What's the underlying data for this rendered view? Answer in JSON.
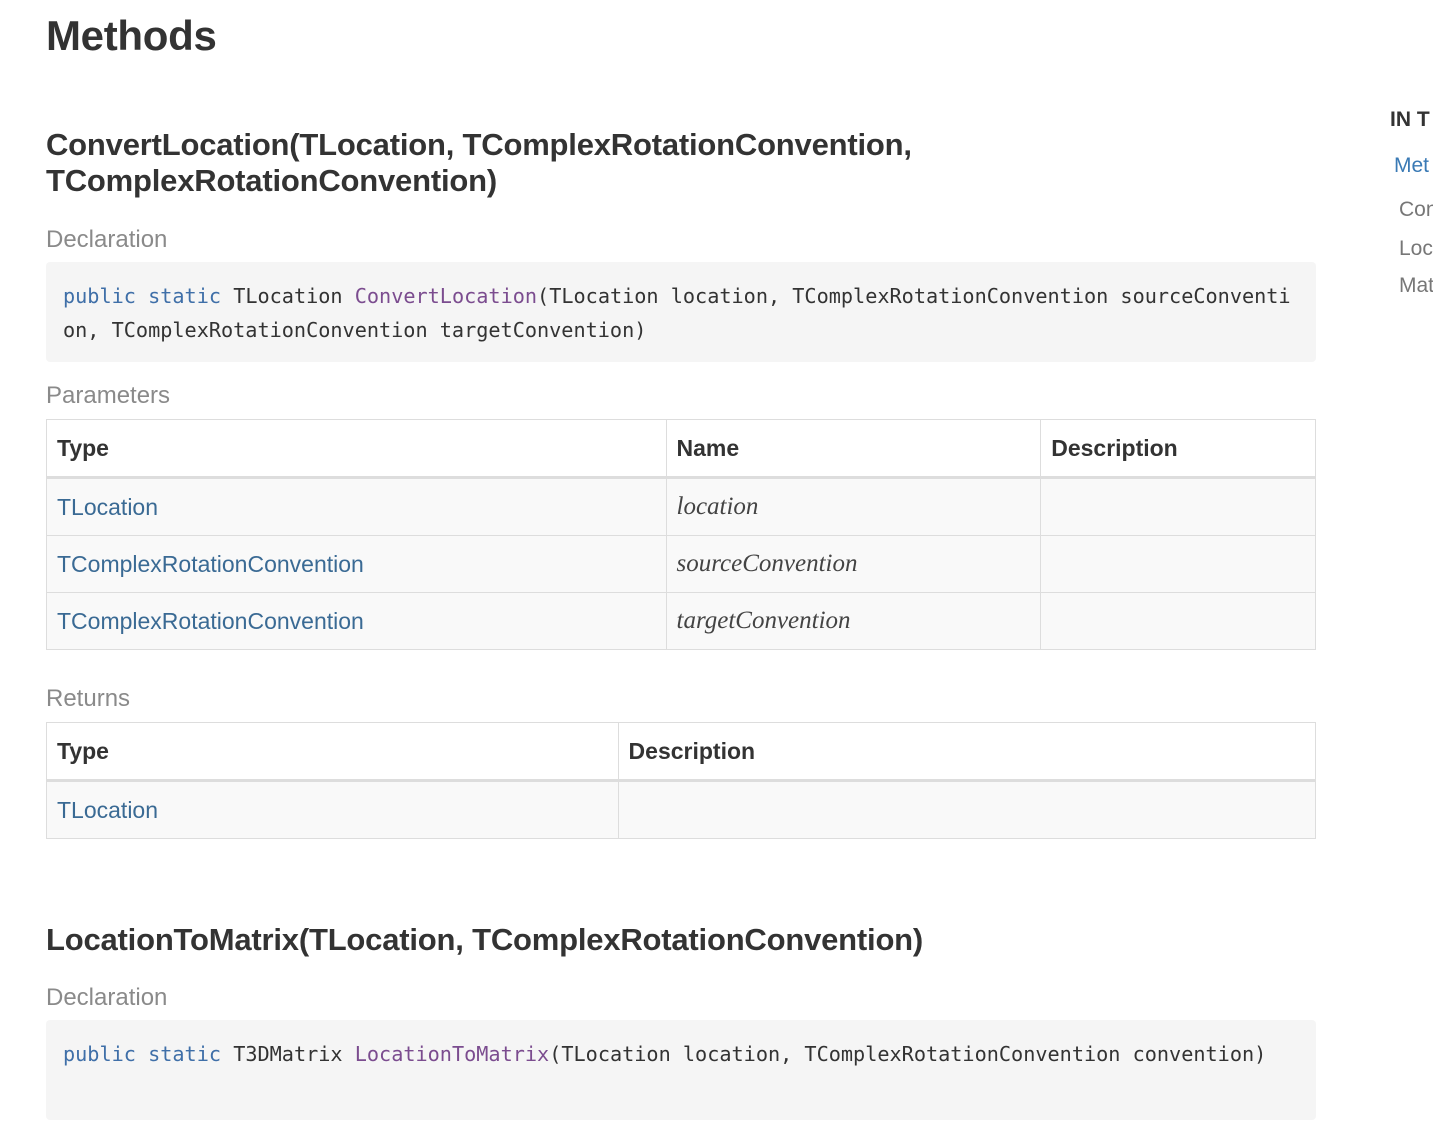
{
  "page": {
    "title": "Methods"
  },
  "toc": {
    "heading": "IN T",
    "items": [
      {
        "label": "Met",
        "active": true
      },
      {
        "label": "Con"
      },
      {
        "label": "Loc"
      },
      {
        "label": "Mat"
      }
    ]
  },
  "labels": {
    "declaration": "Declaration",
    "parameters": "Parameters",
    "returns": "Returns",
    "type": "Type",
    "name": "Name",
    "description": "Description"
  },
  "methods": [
    {
      "title": "ConvertLocation(TLocation, TComplexRotationConvention, TComplexRotationConvention)",
      "declaration": {
        "kw_public": "public",
        "kw_static": "static",
        "return_type": "TLocation",
        "name": "ConvertLocation",
        "args": "(TLocation location, TComplexRotationConvention sourceConvention, TComplexRotationConvention targetConvention)"
      },
      "parameters": [
        {
          "type": "TLocation",
          "name": "location",
          "description": ""
        },
        {
          "type": "TComplexRotationConvention",
          "name": "sourceConvention",
          "description": ""
        },
        {
          "type": "TComplexRotationConvention",
          "name": "targetConvention",
          "description": ""
        }
      ],
      "returns": [
        {
          "type": "TLocation",
          "description": ""
        }
      ]
    },
    {
      "title": "LocationToMatrix(TLocation, TComplexRotationConvention)",
      "declaration": {
        "kw_public": "public",
        "kw_static": "static",
        "return_type": "T3DMatrix",
        "name": "LocationToMatrix",
        "args": "(TLocation location, TComplexRotationConvention convention)"
      }
    }
  ]
}
